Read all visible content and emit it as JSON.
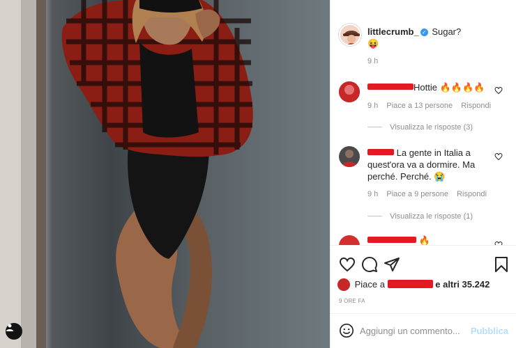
{
  "post": {
    "author": "littlecrumb_",
    "caption": "Sugar?",
    "caption_emoji": "😝",
    "caption_time": "9 h"
  },
  "comments": [
    {
      "text": "Hottie 🔥🔥🔥🔥",
      "time": "9 h",
      "likes": "Piace a 13 persone",
      "reply": "Rispondi",
      "view_replies": "Visualizza le risposte (3)"
    },
    {
      "text": "La gente in Italia a quest'ora va a dormire. Ma perché. Perché. 😭",
      "time": "9 h",
      "likes": "Piace a 9 persone",
      "reply": "Rispondi",
      "view_replies": "Visualizza le risposte (1)"
    },
    {
      "text": "🔥"
    }
  ],
  "likes": {
    "prefix": "Piace a",
    "suffix": "e altri 35.242"
  },
  "timestamp": "9 ORE FA",
  "add_comment": {
    "placeholder": "Aggiungi un commento...",
    "publish": "Pubblica"
  },
  "colors": {
    "verified": "#3897f0",
    "redaction": "#e21b22",
    "publish_disabled": "#b2dffc"
  }
}
